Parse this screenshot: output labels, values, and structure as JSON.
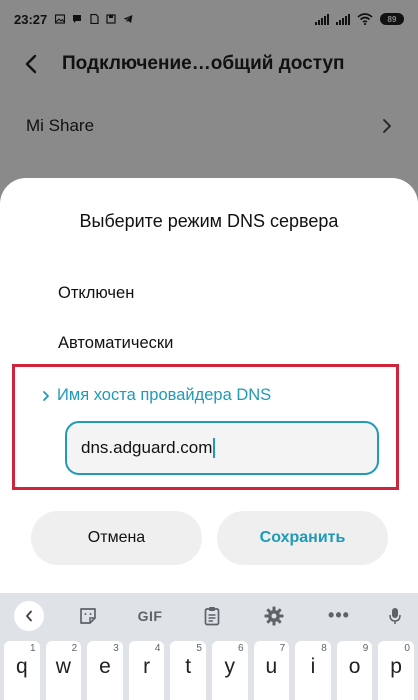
{
  "status_bar": {
    "time": "23:27",
    "battery": "89"
  },
  "topbar": {
    "title": "Подключение…общий доступ"
  },
  "background_list": {
    "item": "Mi Share"
  },
  "dialog": {
    "title": "Выберите режим DNS сервера",
    "options": [
      "Отключен",
      "Автоматически"
    ],
    "selected_option": "Имя хоста провайдера DNS",
    "hostname_value": "dns.adguard.com",
    "cancel_label": "Отмена",
    "save_label": "Сохранить"
  },
  "keyboard": {
    "toolbar_gif": "GIF",
    "keys": [
      {
        "label": "q",
        "hint": "1"
      },
      {
        "label": "w",
        "hint": "2"
      },
      {
        "label": "e",
        "hint": "3"
      },
      {
        "label": "r",
        "hint": "4"
      },
      {
        "label": "t",
        "hint": "5"
      },
      {
        "label": "y",
        "hint": "6"
      },
      {
        "label": "u",
        "hint": "7"
      },
      {
        "label": "i",
        "hint": "8"
      },
      {
        "label": "o",
        "hint": "9"
      },
      {
        "label": "p",
        "hint": "0"
      }
    ]
  },
  "colors": {
    "accent": "#1f9ab7",
    "highlight": "#d0243a",
    "scrim": "#8a8a8a"
  },
  "icons": [
    "chevron-left-icon",
    "chevron-right-icon",
    "sticker-icon",
    "clipboard-icon",
    "gear-icon",
    "more-icon",
    "wifi-icon",
    "signal-icon",
    "battery-icon"
  ]
}
